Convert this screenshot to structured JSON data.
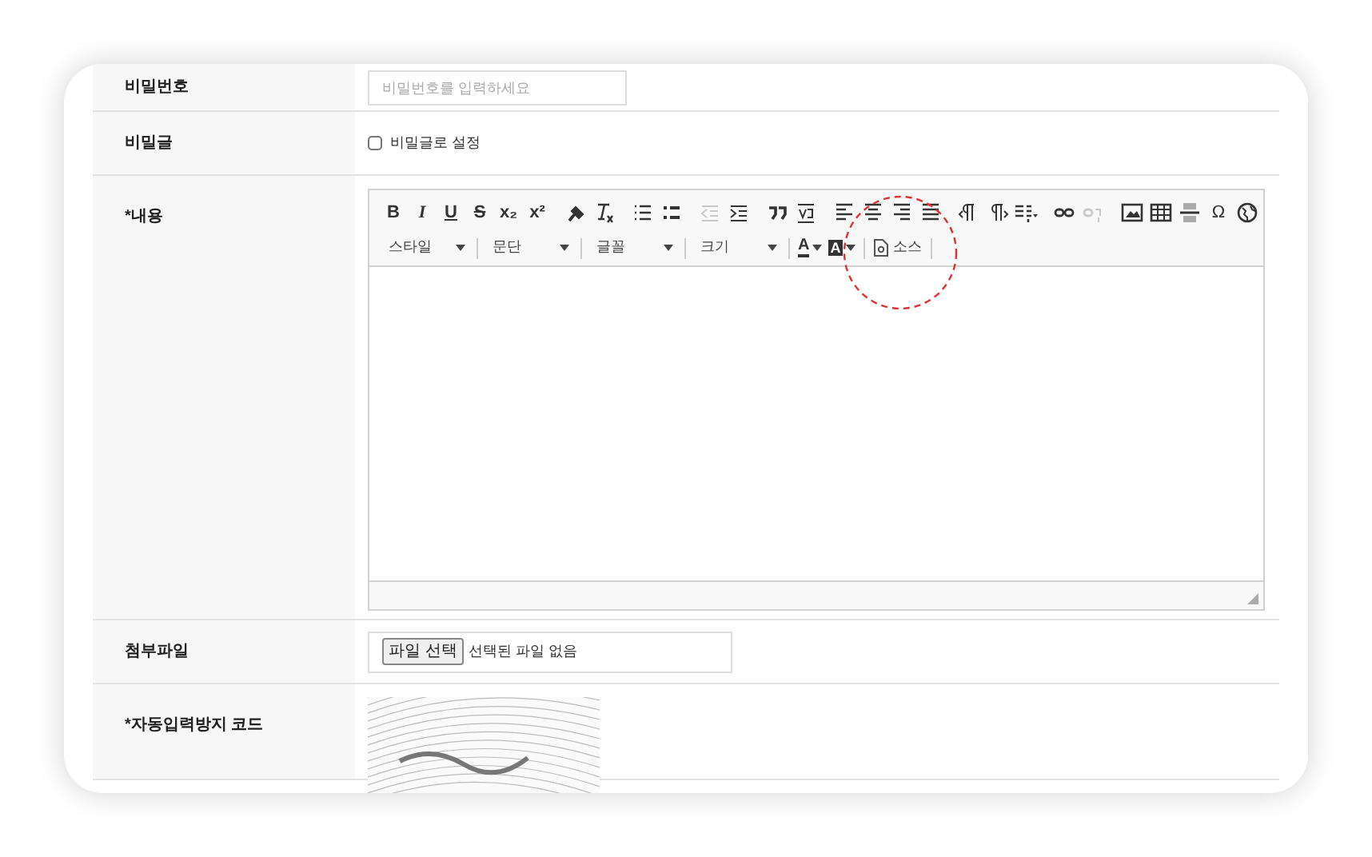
{
  "form": {
    "rows": [
      {
        "kind": "password",
        "label": "비밀번호",
        "placeholder": "비밀번호를 입력하세요"
      },
      {
        "kind": "checkbox",
        "label": "비밀글",
        "option": "비밀글로 설정",
        "checked": false
      },
      {
        "kind": "editor",
        "label": "*내용"
      },
      {
        "kind": "file",
        "label": "첨부파일",
        "button": "파일 선택",
        "status": "선택된 파일 없음"
      },
      {
        "kind": "captcha",
        "label": "*자동입력방지 코드"
      }
    ]
  },
  "editor": {
    "toolbar": [
      [
        {
          "kind": "text",
          "label": "B",
          "disabled": false
        },
        {
          "kind": "text",
          "label": "I",
          "disabled": false
        },
        {
          "kind": "text",
          "label": "U",
          "disabled": false
        },
        {
          "kind": "text",
          "label": "S",
          "disabled": false
        },
        {
          "kind": "text",
          "label": "x₂",
          "disabled": false
        },
        {
          "kind": "text",
          "label": "x²",
          "disabled": false
        }
      ],
      [
        {
          "kind": "icon",
          "disabled": false
        },
        {
          "kind": "icon",
          "disabled": false
        }
      ],
      [
        {
          "kind": "icon",
          "disabled": false
        },
        {
          "kind": "icon",
          "disabled": false
        }
      ],
      [
        {
          "kind": "icon",
          "disabled": true
        },
        {
          "kind": "icon",
          "disabled": false
        }
      ],
      [
        {
          "kind": "icon",
          "disabled": false
        },
        {
          "kind": "icon",
          "disabled": false
        }
      ],
      [
        {
          "kind": "icon",
          "disabled": false
        },
        {
          "kind": "icon",
          "disabled": false
        },
        {
          "kind": "icon",
          "disabled": false
        },
        {
          "kind": "icon",
          "disabled": false
        }
      ],
      [
        {
          "kind": "icon",
          "disabled": false
        },
        {
          "kind": "icon",
          "disabled": false
        },
        {
          "kind": "icon",
          "disabled": false
        }
      ],
      [
        {
          "kind": "icon",
          "disabled": false
        },
        {
          "kind": "icon",
          "disabled": true
        }
      ],
      [
        {
          "kind": "icon",
          "disabled": false
        },
        {
          "kind": "icon",
          "disabled": false
        },
        {
          "kind": "icon",
          "disabled": false
        },
        {
          "kind": "text",
          "label": "Ω",
          "disabled": false
        },
        {
          "kind": "icon",
          "disabled": false
        }
      ]
    ],
    "dropdowns": [
      {
        "label": "스타일"
      },
      {
        "label": "문단"
      },
      {
        "label": "글꼴"
      },
      {
        "label": "크기"
      }
    ],
    "colors": [
      {
        "label": "A",
        "kind": "text"
      },
      {
        "label": "A",
        "kind": "background"
      }
    ],
    "source": {
      "label": "소스"
    },
    "highlight": true
  }
}
